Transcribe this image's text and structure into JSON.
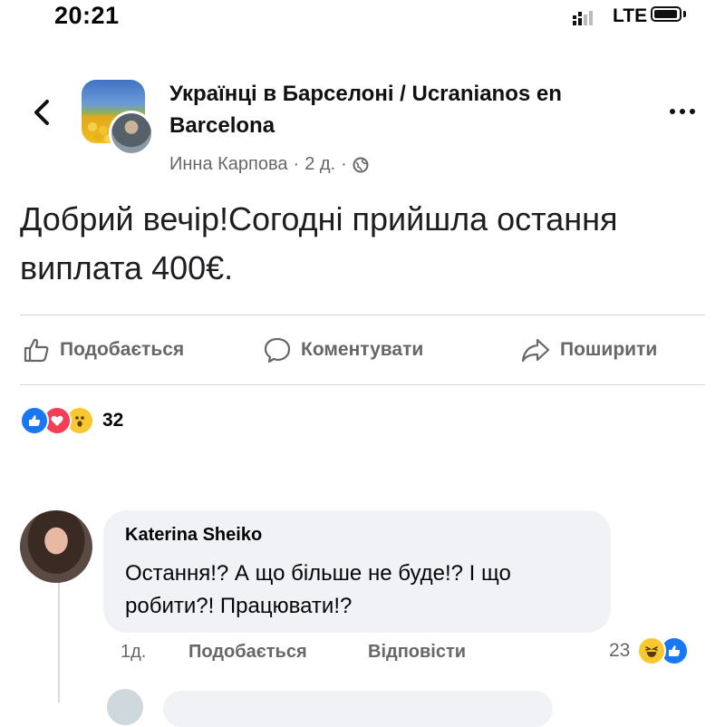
{
  "status_bar": {
    "time": "20:21",
    "network": "LTE"
  },
  "post": {
    "group_name": "Українці в Барселоні / Ucranianos en Barcelona",
    "author": "Инна Карпова",
    "separator": "·",
    "age": "2 д.",
    "audience_icon": "globe-icon",
    "text": "Добрий вечір!Согодні прийшла остання виплата 400€."
  },
  "actions": {
    "like": "Подобається",
    "comment": "Коментувати",
    "share": "Поширити"
  },
  "reactions": {
    "icons": [
      "like-icon",
      "love-icon",
      "wow-icon"
    ],
    "count": "32"
  },
  "comment": {
    "author": "Katerina Sheiko",
    "text": "Остання!? А що більше не буде!? І що робити?! Працювати!?",
    "time": "1д.",
    "like_label": "Подобається",
    "reply_label": "Відповісти",
    "reaction_count": "23",
    "reaction_icons": [
      "haha-icon",
      "like-icon"
    ]
  },
  "colors": {
    "accent": "#1877f2",
    "love": "#f33e58",
    "wow": "#f7c830",
    "muted_text": "#65676b",
    "bubble_bg": "#f0f2f5"
  }
}
